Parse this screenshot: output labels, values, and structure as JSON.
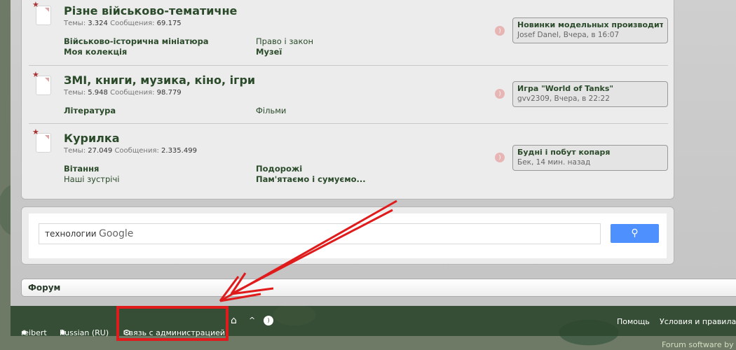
{
  "nodes": [
    {
      "title": "Різне військово-тематичне",
      "stats_topics_label": "Темы:",
      "topics": "3.324",
      "stats_posts_label": "Сообщения:",
      "posts": "69.175",
      "subforums": [
        "Військово-історична мініатюра",
        "Право і закон",
        "Моя колекція",
        "Музеї"
      ],
      "last_title": "Новинки модельных производите...",
      "last_meta": "Josef Danel, Вчера, в 16:07"
    },
    {
      "title": "ЗМІ, книги, музика, кіно, ігри",
      "stats_topics_label": "Темы:",
      "topics": "5.948",
      "stats_posts_label": "Сообщения:",
      "posts": "98.779",
      "subforums": [
        "Література",
        "Фільми"
      ],
      "last_title": "Игра \"World of Tanks\"",
      "last_meta": "gvv2309, Вчера, в 22:22"
    },
    {
      "title": "Курилка",
      "stats_topics_label": "Темы:",
      "topics": "27.049",
      "stats_posts_label": "Сообщения:",
      "posts": "2.335.499",
      "subforums": [
        "Вітання",
        "Подорожі",
        "Наші зустрічі",
        "Пам'ятаємо і сумуємо..."
      ],
      "last_title": "Будні і побут копаря",
      "last_meta": "Бек, 14 мин. назад"
    }
  ],
  "search": {
    "value": "технологии",
    "brand": "Google",
    "button_icon": "search-icon"
  },
  "breadcrumb": "Форум",
  "footer": {
    "style": "reibert",
    "language": "Russian (RU)",
    "contact": "Связь с администрацией",
    "help": "Помощь",
    "terms": "Условия и правила",
    "credit": "Forum software by Xe"
  },
  "colors": {
    "annotation": "#e01b1b",
    "accent": "#2a4a2a",
    "search_button": "#4d90fe"
  }
}
